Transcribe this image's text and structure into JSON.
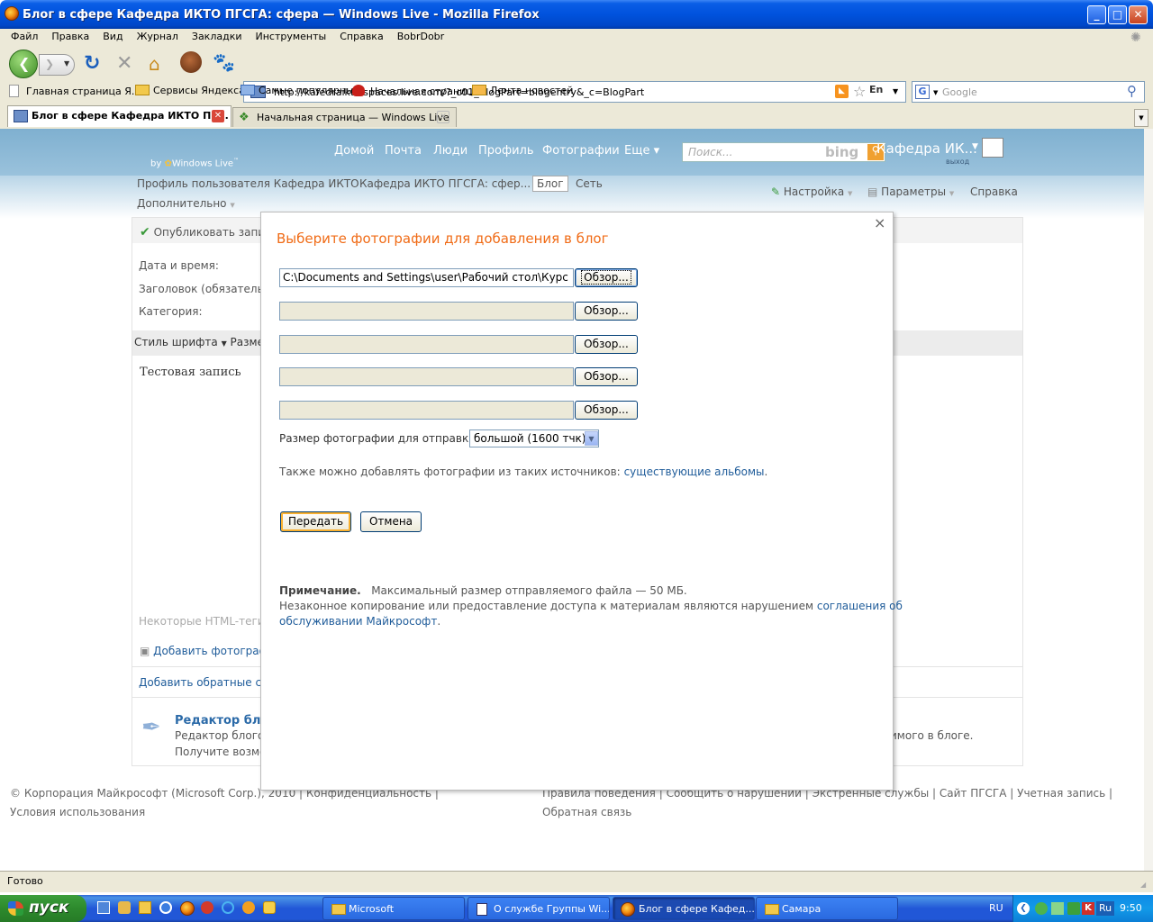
{
  "window": {
    "title": "Блог в сфере Кафедра ИКТО ПГСГА: сфера — Windows Live - Mozilla Firefox"
  },
  "menubar": [
    "Файл",
    "Правка",
    "Вид",
    "Журнал",
    "Закладки",
    "Инструменты",
    "Справка",
    "BobrDobr"
  ],
  "navbar": {
    "url": "http://kafedraikto.spaces.live.com/?_c01_BlogPart=blogentry&_c=BlogPart",
    "lang": "En",
    "search_placeholder": "Google"
  },
  "bookmarks": [
    "Главная страница Я...",
    "Сервисы Яндекса",
    "Самые популярные",
    "Начальная страница",
    "Лента новостей"
  ],
  "tabs": [
    {
      "label": "Блог в сфере Кафедра ИКТО ПГ...",
      "active": true
    },
    {
      "label": "Начальная страница — Windows Live",
      "active": false
    }
  ],
  "site": {
    "by": "by",
    "brand": "Windows Live",
    "brand_tm": "™",
    "topnav": [
      "Домой",
      "Почта",
      "Люди",
      "Профиль",
      "Фотографии",
      "Еще ▾"
    ],
    "search_placeholder": "Поиск...",
    "bing": "bing",
    "username": "Кафедра ИК...",
    "logout": "выход",
    "crumbs": [
      "Профиль пользователя Кафедра ИКТО",
      "Кафедра ИКТО ПГСГА: сфер...",
      "Блог",
      "Сеть"
    ],
    "more": "Дополнительно",
    "right_links": [
      "Настройка",
      "Параметры",
      "Справка"
    ]
  },
  "background_form": {
    "publish": "Опубликовать запи",
    "datetime": "Дата и время:",
    "heading": "Заголовок (обязательн",
    "category": "Категория:",
    "font_style": "Стиль шрифта",
    "font_size": "Разме",
    "editor_text": "Тестовая запись",
    "html_tags": "Некоторые HTML-теги",
    "add_photo": "Добавить фотограф",
    "add_trackbacks": "Добавить обратные сс",
    "editor_title": "Редактор блог",
    "editor_line1": "Редактор блогов",
    "editor_line2": "Получите возмо",
    "editor_right": "имого в блоге."
  },
  "footer": {
    "left": [
      "© Корпорация Майкрософт (Microsoft Corp.), 2010",
      "Конфиденциальность",
      "Условия использования"
    ],
    "right": [
      "Правила поведения",
      "Сообщить о нарушении",
      "Экстренные службы",
      "Сайт ПГСГА",
      "Учетная запись",
      "Обратная связь"
    ]
  },
  "modal": {
    "close": "×",
    "title": "Выберите фотографии для добавления в блог",
    "files": [
      "C:\\Documents and Settings\\user\\Рабочий стол\\Курс",
      "",
      "",
      "",
      ""
    ],
    "browse_label": "Обзор...",
    "size_label": "Размер фотографии для отправки:",
    "size_value": "большой (1600 тчк)",
    "also_text": "Также можно добавлять фотографии из таких источников:",
    "also_link": "существующие альбомы",
    "submit": "Передать",
    "cancel": "Отмена",
    "note_label": "Примечание.",
    "note_text": "Максимальный размер отправляемого файла — 50 МБ.",
    "legal_text": "Незаконное копирование или предоставление доступа к материалам являются нарушением",
    "legal_link1": "соглашения об",
    "legal_link2": "обслуживании Майкрософт",
    "legal_end": "."
  },
  "status": "Готово",
  "taskbar": {
    "start": "пуск",
    "tasks": [
      {
        "label": "Microsoft",
        "active": false
      },
      {
        "label": "О службе Группы Wi...",
        "active": false
      },
      {
        "label": "Блог в сфере Кафед...",
        "active": true
      },
      {
        "label": "Самара",
        "active": false
      }
    ],
    "lang": "RU",
    "tray_lang": "Ru",
    "time": "9:50"
  }
}
